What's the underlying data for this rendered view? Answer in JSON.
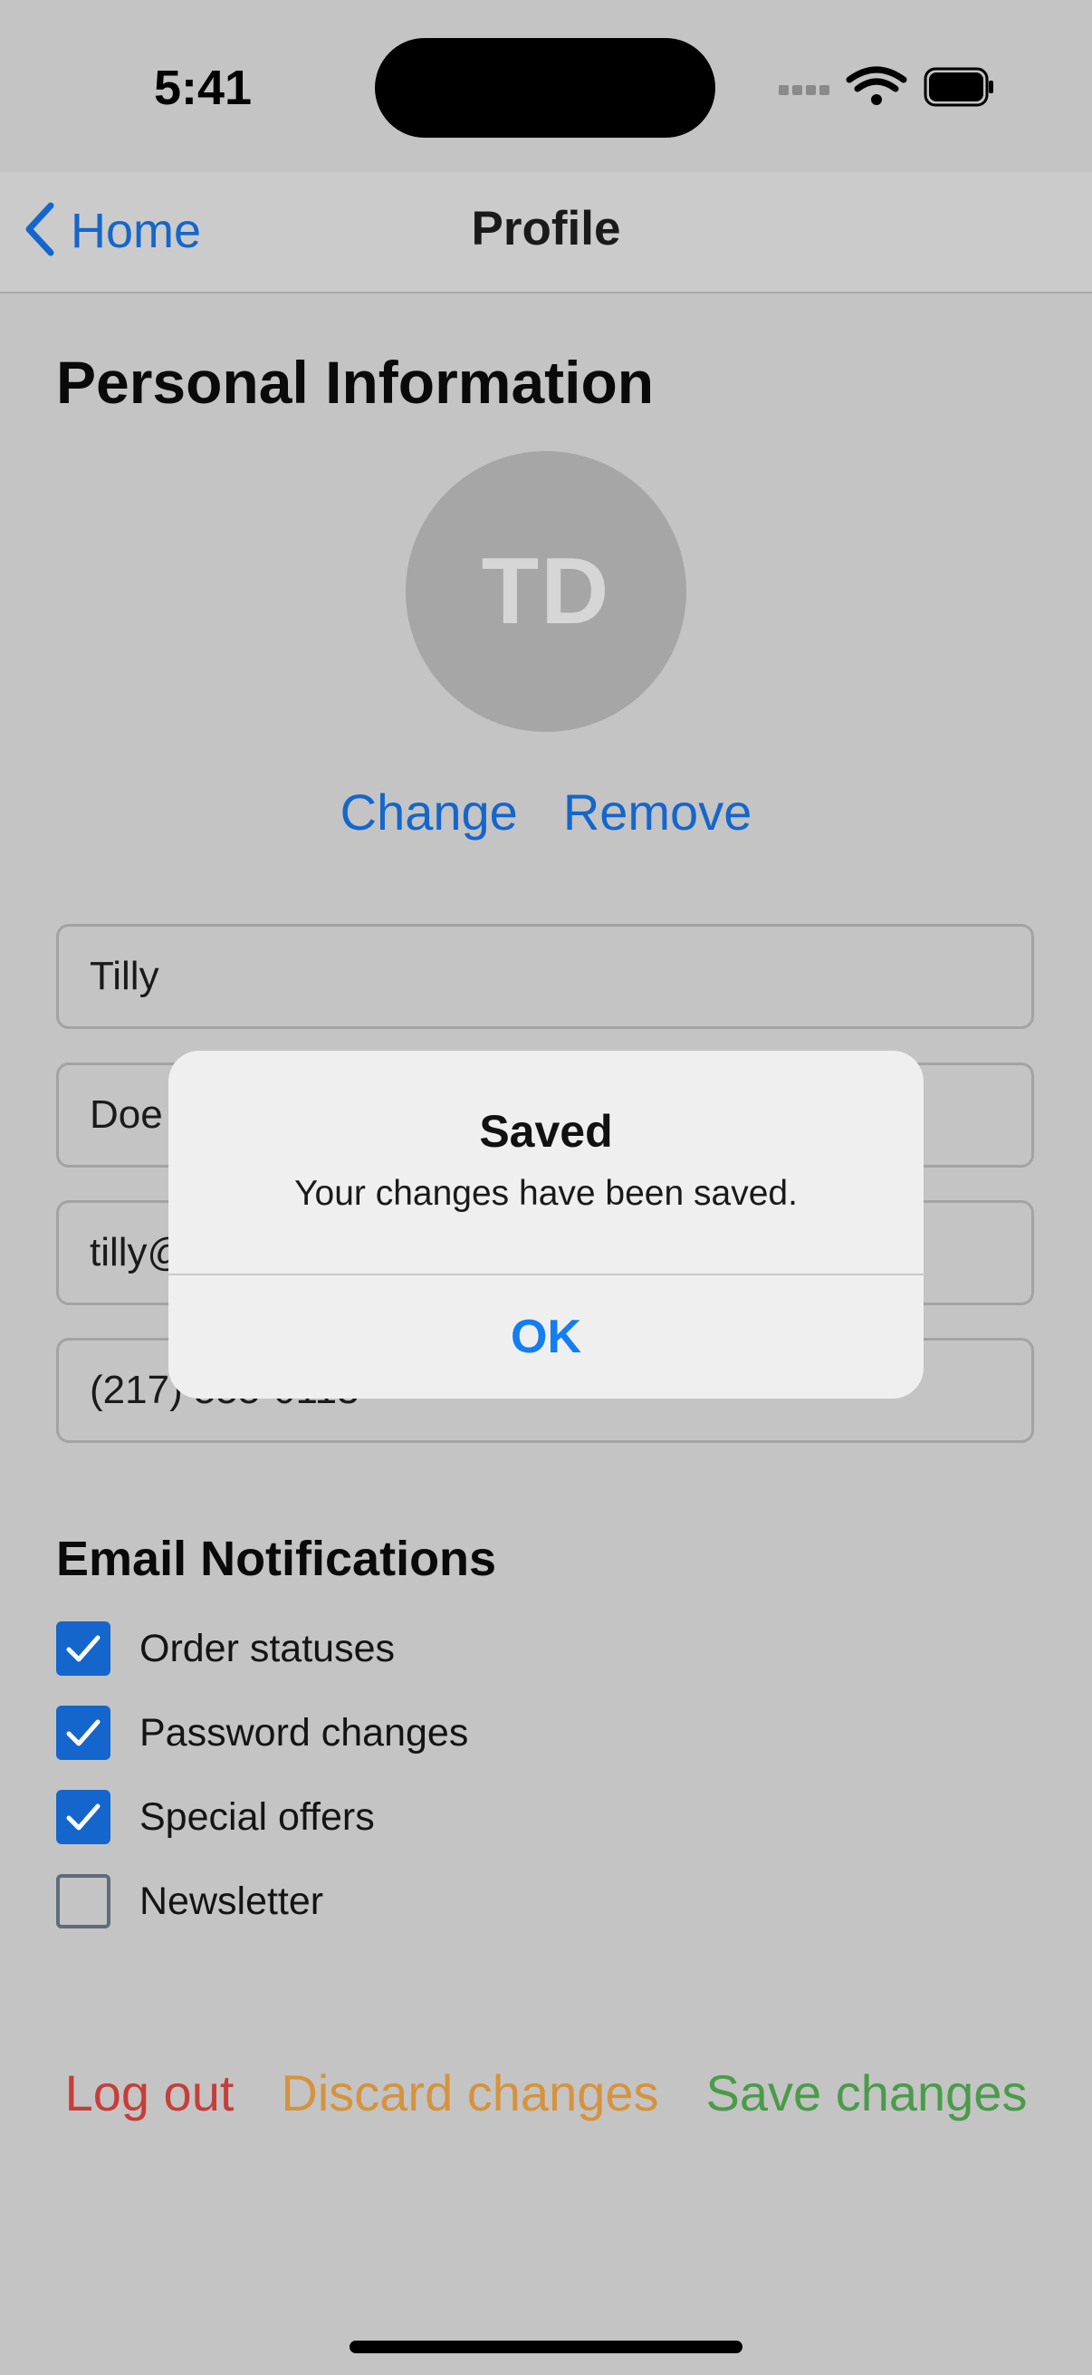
{
  "status_bar": {
    "time": "5:41"
  },
  "nav": {
    "back_label": "Home",
    "title": "Profile"
  },
  "personal": {
    "title": "Personal Information",
    "avatar_initials": "TD",
    "change_label": "Change",
    "remove_label": "Remove"
  },
  "fields": {
    "first_name": "Tilly",
    "last_name": "Doe",
    "email": "tilly@",
    "phone": "(217) 555-0113"
  },
  "notifications": {
    "title": "Email Notifications",
    "items": [
      {
        "label": "Order statuses",
        "checked": true
      },
      {
        "label": "Password changes",
        "checked": true
      },
      {
        "label": "Special offers",
        "checked": true
      },
      {
        "label": "Newsletter",
        "checked": false
      }
    ]
  },
  "actions": {
    "logout_label": "Log out",
    "discard_label": "Discard changes",
    "save_label": "Save changes"
  },
  "alert": {
    "title": "Saved",
    "message": "Your changes have been saved.",
    "ok_label": "OK"
  },
  "colors": {
    "accent": "#1466cc",
    "alert_button": "#137ef0",
    "logout": "#c63e39",
    "discard": "#d6933d",
    "save": "#4a9b4a"
  },
  "icons": {
    "back": "chevron-left-icon",
    "wifi": "wifi-icon",
    "battery": "battery-icon",
    "signal": "cellular-signal-icon",
    "checkmark": "checkmark-icon"
  }
}
